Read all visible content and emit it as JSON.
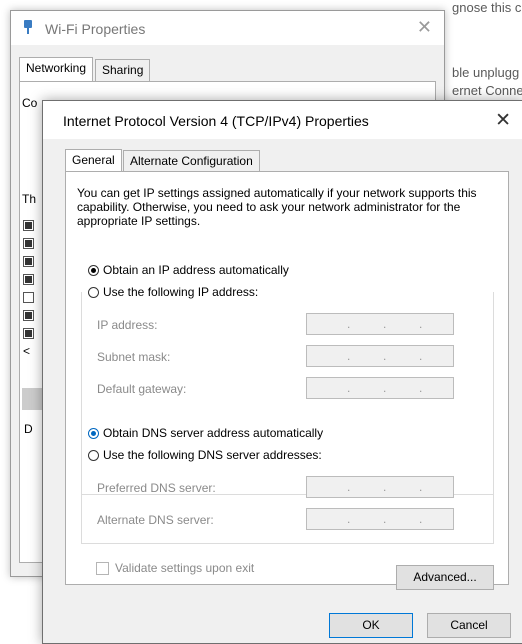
{
  "background": {
    "frag_top": "gnose this c",
    "frag_mid1": "ble unplugg",
    "frag_mid2": "ernet Conne"
  },
  "wifi_window": {
    "title": "Wi-Fi Properties",
    "tabs": [
      "Networking",
      "Sharing"
    ],
    "frag_connect": "Co",
    "frag_this": "Th",
    "frag_desc": "D",
    "arrow": "<"
  },
  "dialog": {
    "title": "Internet Protocol Version 4 (TCP/IPv4) Properties",
    "tabs": [
      "General",
      "Alternate Configuration"
    ],
    "intro": "You can get IP settings assigned automatically if your network supports this capability. Otherwise, you need to ask your network administrator for the appropriate IP settings.",
    "ip_auto": "Obtain an IP address automatically",
    "ip_manual": "Use the following IP address:",
    "ip_fields": [
      {
        "label": "IP address:",
        "value": ""
      },
      {
        "label": "Subnet mask:",
        "value": ""
      },
      {
        "label": "Default gateway:",
        "value": ""
      }
    ],
    "dns_auto": "Obtain DNS server address automatically",
    "dns_manual": "Use the following DNS server addresses:",
    "dns_fields": [
      {
        "label": "Preferred DNS server:",
        "value": ""
      },
      {
        "label": "Alternate DNS server:",
        "value": ""
      }
    ],
    "ip_dot": ".",
    "validate": "Validate settings upon exit",
    "advanced": "Advanced...",
    "ok": "OK",
    "cancel": "Cancel"
  },
  "icons": {
    "wifi": "network-adapter-icon",
    "close": "close-icon"
  },
  "colors": {
    "accent": "#0067c0",
    "window_bg": "#f0f0f0"
  }
}
